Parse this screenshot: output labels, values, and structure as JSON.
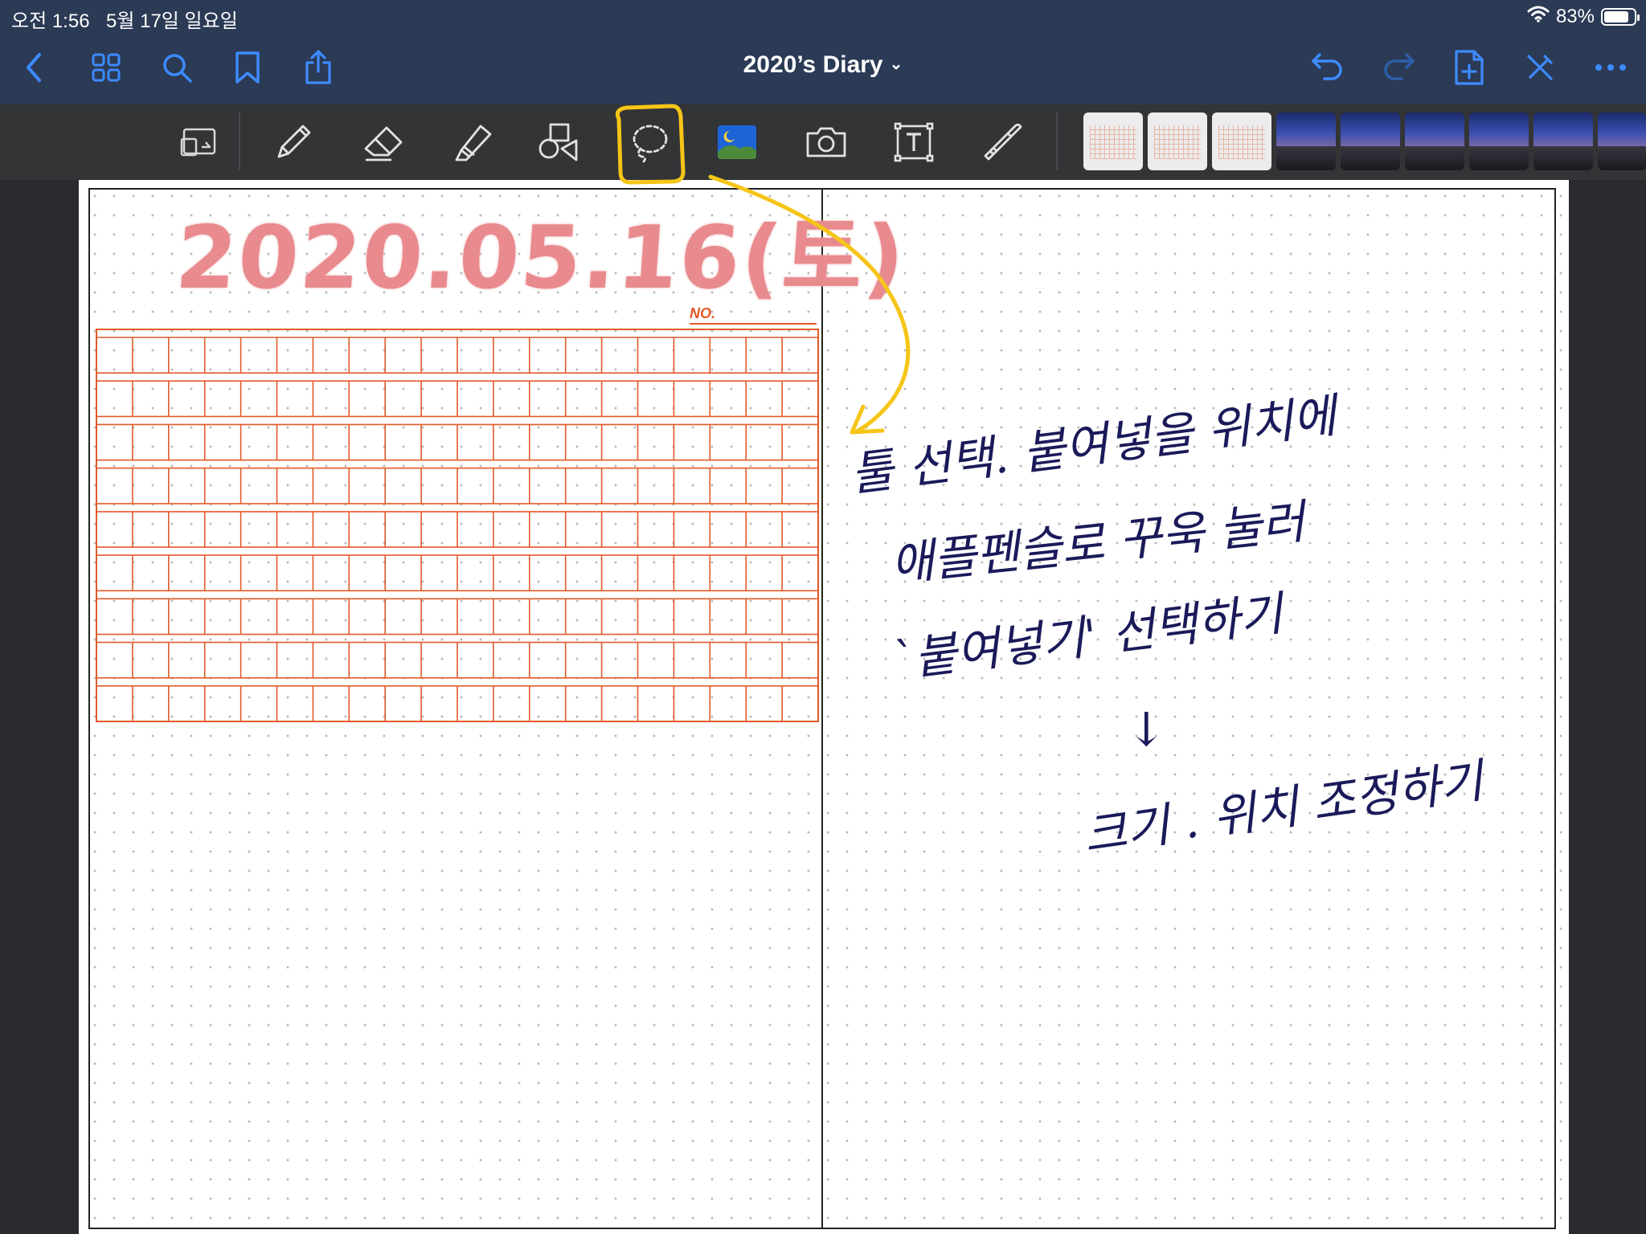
{
  "status_bar": {
    "time": "오전 1:56",
    "date": "5월 17일 일요일",
    "battery_percent": "83%",
    "battery_level": 0.83
  },
  "nav": {
    "title": "2020’s Diary",
    "title_chevron": "⌄",
    "left_icons": [
      "back-chevron-icon",
      "grid-icon",
      "search-icon",
      "bookmark-icon",
      "share-icon"
    ],
    "right_icons": [
      "undo-icon",
      "redo-icon",
      "add-page-icon",
      "pen-off-icon",
      "more-icon"
    ]
  },
  "toolbar": {
    "tools": [
      "zoom-window",
      "pen",
      "eraser",
      "highlighter",
      "shapes",
      "lasso",
      "image",
      "camera",
      "text",
      "laser-pointer"
    ],
    "selected_tool": "lasso",
    "highlight_color": "#f5c518",
    "thumbnails": [
      "grid-template",
      "grid-template",
      "grid-template",
      "photo",
      "photo",
      "photo",
      "photo",
      "photo",
      "photo"
    ]
  },
  "page": {
    "date_heading": "2020.05.16(토)",
    "no_label": "NO.",
    "grid": {
      "rows": 9,
      "cols": 20,
      "color": "#e25a2a"
    },
    "handwritten_notes": [
      "툴 선택. 붙여넣을 위치에",
      "애플펜슬로  꾸욱 눌러",
      "`붙여넣기'  선택하기",
      "↓",
      "크기 . 위치 조정하기"
    ],
    "ink_color": "#1a1a5a"
  },
  "colors": {
    "nav_background": "#2b3a55",
    "accent_blue": "#3d8bff",
    "toolbar_background": "#333436",
    "date_pink": "#e88a8e"
  }
}
